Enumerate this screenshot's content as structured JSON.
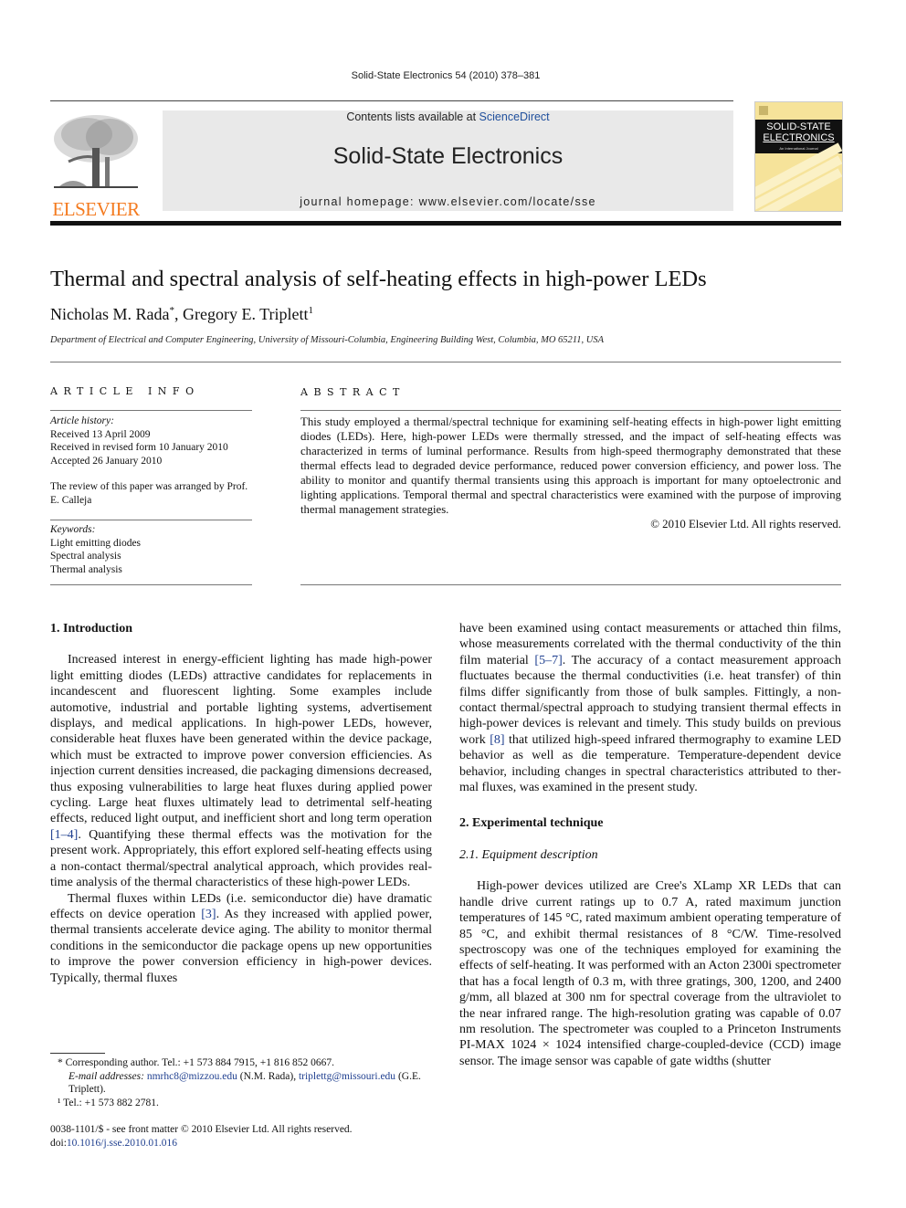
{
  "running_head": "Solid-State Electronics 54 (2010) 378–381",
  "banner": {
    "contents_prefix": "Contents lists available at ",
    "contents_link": "ScienceDirect",
    "journal_title": "Solid-State Electronics",
    "homepage": "journal homepage: www.elsevier.com/locate/sse"
  },
  "publisher_logo": {
    "text": "ELSEVIER",
    "color": "#f47b20"
  },
  "cover": {
    "title_line1": "SOLID-STATE",
    "title_line2": "ELECTRONICS",
    "subtitle": "An International Journal",
    "background": "#f6e39a"
  },
  "article": {
    "title": "Thermal and spectral analysis of self-heating effects in high-power LEDs",
    "authors": [
      {
        "name": "Nicholas M. Rada",
        "mark": "*"
      },
      {
        "name": "Gregory E. Triplett",
        "mark": "1"
      }
    ],
    "author_separator": ", ",
    "affiliation": "Department of Electrical and Computer Engineering, University of Missouri-Columbia, Engineering Building West, Columbia, MO 65211, USA"
  },
  "article_info": {
    "heading": "ARTICLE INFO",
    "history_label": "Article history:",
    "history": [
      "Received 13 April 2009",
      "Received in revised form 10 January 2010",
      "Accepted 26 January 2010"
    ],
    "review_note": "The review of this paper was arranged by Prof. E. Calleja",
    "keywords_label": "Keywords:",
    "keywords": [
      "Light emitting diodes",
      "Spectral analysis",
      "Thermal analysis"
    ]
  },
  "abstract": {
    "heading": "ABSTRACT",
    "text": "This study employed a thermal/spectral technique for examining self-heating effects in high-power light emitting diodes (LEDs). Here, high-power LEDs were thermally stressed, and the impact of self-heating effects was characterized in terms of luminal performance. Results from high-speed thermography dem­onstrated that these thermal effects lead to degraded device performance, reduced power conversion effi­ciency, and power loss. The ability to monitor and quantify thermal transients using this approach is important for many optoelectronic and lighting applications. Temporal thermal and spectral characteris­tics were examined with the purpose of improving thermal management strategies.",
    "copyright": "© 2010 Elsevier Ltd. All rights reserved."
  },
  "sections": {
    "intro": {
      "heading": "1. Introduction",
      "p1_a": "Increased interest in energy-efficient lighting has made high-power light emitting diodes (LEDs) attractive candidates for replacements in incandescent and fluorescent lighting. Some examples include automotive, industrial and portable lighting sys­tems, advertisement displays, and medical applications. In high-power LEDs, however, considerable heat fluxes have been gener­ated within the device package, which must be extracted to im­prove power conversion efficiencies. As injection current densities increased, die packaging dimensions decreased, thus exposing vulnerabilities to large heat fluxes during applied power cycling. Large heat fluxes ultimately lead to detrimental self-heat­ing effects, reduced light output, and inefficient short and long term operation ",
      "p1_ref": "[1–4]",
      "p1_b": ". Quantifying these thermal effects was the motivation for the present work. Appropriately, this effort explored self-heating effects using a non-contact thermal/spectral analytical approach, which provides real-time analysis of the thermal charac­teristics of these high-power LEDs.",
      "p2_a": "Thermal fluxes within LEDs (i.e. semiconductor die) have dra­matic effects on device operation ",
      "p2_ref": "[3]",
      "p2_b": ". As they increased with ap­plied power, thermal transients accelerate device aging. The ability to monitor thermal conditions in the semiconductor die package opens up new opportunities to improve the power conver­sion efficiency in high-power devices. Typically, thermal fluxes ",
      "p2_c": "have been examined using contact measurements or attached thin films, whose measurements correlated with the thermal conduc­tivity of the thin film material ",
      "p2_ref2": "[5–7]",
      "p2_d": ". The accuracy of a contact measurement approach fluctuates because the thermal conductiv­ities (i.e. heat transfer) of thin films differ significantly from those of bulk samples. Fittingly, a non-contact thermal/spectral approach to studying transient thermal effects in high-power devices is rel­evant and timely. This study builds on previous work ",
      "p2_ref3": "[8]",
      "p2_e": " that uti­lized high-speed infrared thermography to examine LED behavior as well as die temperature. Temperature-dependent device behav­ior, including changes in spectral characteristics attributed to ther­mal fluxes, was examined in the present study."
    },
    "experimental": {
      "heading": "2. Experimental technique",
      "subheading": "2.1. Equipment description",
      "p1": "High-power devices utilized are Cree's XLamp XR LEDs that can handle drive current ratings up to 0.7 A, rated maximum junction temperatures of 145 °C, rated maximum ambient operating tem­perature of 85 °C, and exhibit thermal resistances of 8 °C/W. Time-resolved spectroscopy was one of the techniques employed for examining the effects of self-heating. It was performed with an Acton 2300i spectrometer that has a focal length of 0.3 m, with three gratings, 300, 1200, and 2400 g/mm, all blazed at 300 nm for spectral coverage from the ultraviolet to the near infrared range. The high-resolution grating was capable of 0.07 nm resolution. The spectrometer was coupled to a Princeton Instruments PI-MAX 1024 × 1024 intensified charge-coupled-device (CCD) image sensor. The image sensor was capable of gate widths (shutter"
    }
  },
  "footnotes": {
    "corresponding": "* Corresponding author. Tel.: +1 573 884 7915, +1 816 852 0667.",
    "email_label": "E-mail addresses:",
    "email1": "nmrhc8@mizzou.edu",
    "email1_owner": " (N.M. Rada), ",
    "email2": "triplettg@missouri.edu",
    "email2_owner": " (G.E. Triplett).",
    "note1": "¹ Tel.: +1 573 882 2781."
  },
  "front_matter": {
    "issn": "0038-1101/$ - see front matter © 2010 Elsevier Ltd. All rights reserved.",
    "doi_prefix": "doi:",
    "doi": "10.1016/j.sse.2010.01.016"
  },
  "colors": {
    "link": "#1f3f8f",
    "banner_bg": "#e9e9e9"
  }
}
